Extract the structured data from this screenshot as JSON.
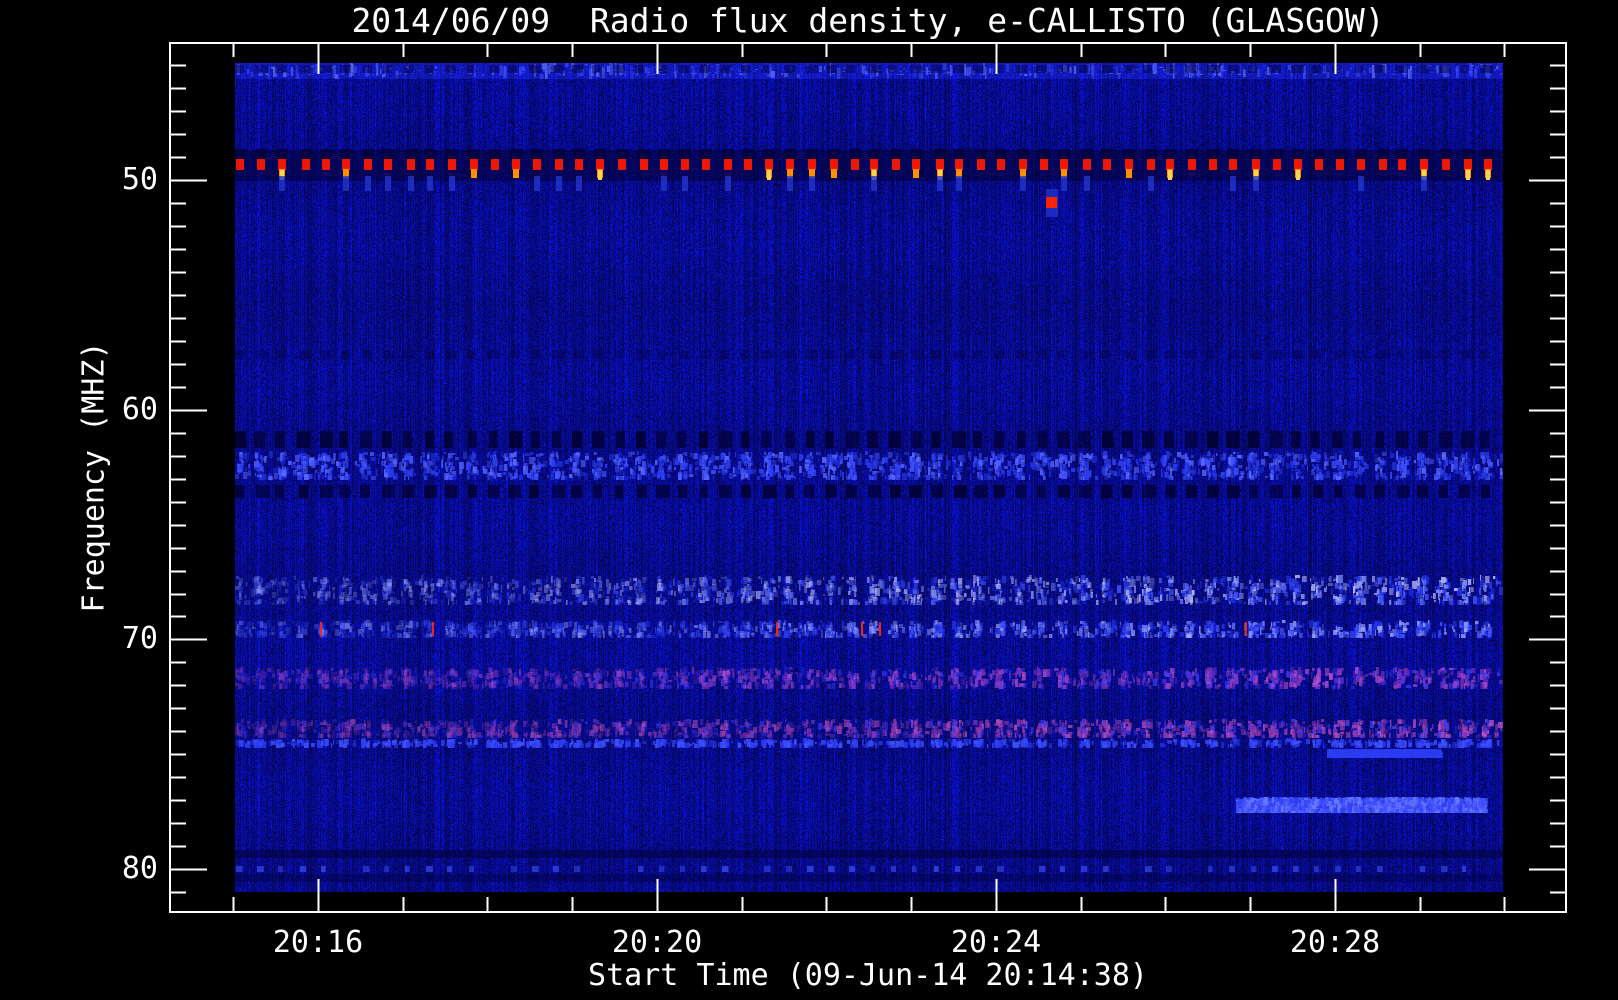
{
  "chart_data": {
    "type": "heatmap",
    "subtype": "radio-spectrogram",
    "title": "2014/06/09  Radio flux density, e-CALLISTO (GLASGOW)",
    "xlabel": "Start Time (09-Jun-14 20:14:38)",
    "ylabel": "Frequency (MHZ)",
    "x_axis": {
      "major_ticks": [
        {
          "label": "20:16",
          "minute_offset": 1
        },
        {
          "label": "20:20",
          "minute_offset": 5
        },
        {
          "label": "20:24",
          "minute_offset": 9
        },
        {
          "label": "20:28",
          "minute_offset": 13
        }
      ],
      "minor_tick_every_min": 1,
      "minutes_span": 15,
      "data_start": "20:15:00",
      "data_end": "20:30:00"
    },
    "y_axis": {
      "major_ticks": [
        50,
        60,
        70,
        80
      ],
      "minor_tick_every_mhz": 1,
      "minor_tick_range_mhz": [
        45,
        81
      ],
      "freq_min_mhz": 44.9,
      "freq_max_mhz": 81.0,
      "inverted": true
    },
    "colormap": {
      "background": "#000000",
      "axis": "#ffffff",
      "noise_low": "#000078",
      "noise_mid": "#0a0aa8",
      "noise_high": "#2a3ae0",
      "hot": [
        "#ee1703",
        "#ff9100",
        "#ffd24d"
      ]
    },
    "features": [
      {
        "id": "top-edge-bright-rows",
        "type": "bright_rows",
        "f0": 44.9,
        "f1": 45.6
      },
      {
        "id": "top-edge-dark-dashes",
        "type": "dash_row",
        "f0": 45.0,
        "f1": 45.35,
        "period_s": 15,
        "color": "#000030",
        "alpha": 0.5
      },
      {
        "id": "pulse-band-dark-underlay",
        "type": "dark_rows",
        "f0": 48.7,
        "f1": 50.05,
        "alpha": 0.5
      },
      {
        "id": "calibration-pulse-train-49.5MHz-every-15s",
        "type": "pulse_train",
        "period_s": 15,
        "rows": {
          "dark": [
            48.65,
            49.1
          ],
          "red": [
            49.1,
            49.55
          ],
          "orange": [
            49.5,
            49.9
          ],
          "tail": [
            49.8,
            50.45
          ]
        },
        "colors": {
          "dark": "#000040",
          "red": "#ee1703",
          "orange": "#ff9100",
          "yellow": "#ffd24d",
          "tail": "#2336cc"
        },
        "orange_fraction": 0.28,
        "tail_fraction": 0.38
      },
      {
        "id": "isolated-burst-51MHz-2024.6",
        "type": "point_burst",
        "time_s": 579,
        "f0": 50.72,
        "f1": 51.2,
        "halo_f0": 50.4,
        "halo_f1": 51.62,
        "color": "#ff2200",
        "halo_color": "#2336cc"
      },
      {
        "id": "faint-dark-dashes-57.6MHz",
        "type": "dash_row",
        "f0": 57.4,
        "f1": 57.8,
        "period_s": 15,
        "color": "#000030",
        "alpha": 0.33
      },
      {
        "id": "dark-rfi-band-61.3MHz",
        "type": "dash_row",
        "f0": 60.9,
        "f1": 61.65,
        "period_s": 15,
        "color": "#000026",
        "alpha": 0.8
      },
      {
        "id": "bright-stripe-band-62.5MHz",
        "type": "speckle_band",
        "f0": 61.8,
        "f1": 63.05,
        "colors": [
          "#1f2fd6",
          "#2c3cf2",
          "#4152ff",
          "#5a6aff"
        ],
        "density": 2.4
      },
      {
        "id": "dark-rfi-band-63.5MHz",
        "type": "dash_row",
        "f0": 63.25,
        "f1": 63.85,
        "period_s": 15,
        "color": "#000026",
        "alpha": 0.8
      },
      {
        "id": "speckle-band-68MHz",
        "type": "speckle_band",
        "f0": 67.2,
        "f1": 68.5,
        "colors": [
          "#2233ee",
          "#4457ff",
          "#8899f2",
          "#c9c9ff"
        ],
        "density": 2.2,
        "right_boost": true
      },
      {
        "id": "speckle-band-69.5MHz-with-red-ticks",
        "type": "speckle_band",
        "f0": 69.15,
        "f1": 69.95,
        "colors": [
          "#2233ee",
          "#4457ff",
          "#9aa6ff"
        ],
        "density": 1.8,
        "right_boost": true,
        "red_ticks": 6
      },
      {
        "id": "purple-speckle-band-71.7MHz",
        "type": "speckle_band",
        "f0": 71.2,
        "f1": 72.15,
        "colors": [
          "#6a2bb8",
          "#9a3ec0",
          "#b44fd0",
          "#3b3bee"
        ],
        "density": 1.9,
        "right_boost": true
      },
      {
        "id": "magenta-speckle-band-73.9MHz",
        "type": "speckle_band",
        "f0": 73.45,
        "f1": 74.3,
        "colors": [
          "#a03aa8",
          "#c055c0",
          "#8833aa",
          "#3b3bee"
        ],
        "density": 1.9,
        "right_boost": true
      },
      {
        "id": "blue-row-74.5MHz",
        "type": "speckle_band",
        "f0": 74.3,
        "f1": 74.7,
        "colors": [
          "#2c3cf2",
          "#4152ff"
        ],
        "density": 1.2
      },
      {
        "id": "faint-blue-dashes-75MHz-right",
        "type": "speckle_band",
        "f0": 74.75,
        "f1": 75.15,
        "t0": 775,
        "t1": 855,
        "colors": [
          "#2c3cf2"
        ],
        "density": 1.4,
        "alpha": 0.5
      },
      {
        "id": "bright-blue-dashes-77.2MHz-right",
        "type": "speckle_band",
        "f0": 76.85,
        "f1": 77.55,
        "t0": 710,
        "t1": 886,
        "colors": [
          "#2c3cf2",
          "#4152ff",
          "#6a7aff"
        ],
        "density": 3.4
      },
      {
        "id": "dark-stripe-79.3MHz",
        "type": "dark_rows",
        "f0": 79.15,
        "f1": 79.5,
        "alpha": 0.5
      },
      {
        "id": "dotted-row-79.9MHz",
        "type": "dash_row_bright",
        "f0": 79.85,
        "f1": 80.1,
        "period_s": 15,
        "color": "#3a4aef",
        "alpha": 0.8
      },
      {
        "id": "dark-stripe-80.35MHz",
        "type": "dark_rows",
        "f0": 80.2,
        "f1": 80.55,
        "alpha": 0.35
      }
    ]
  }
}
